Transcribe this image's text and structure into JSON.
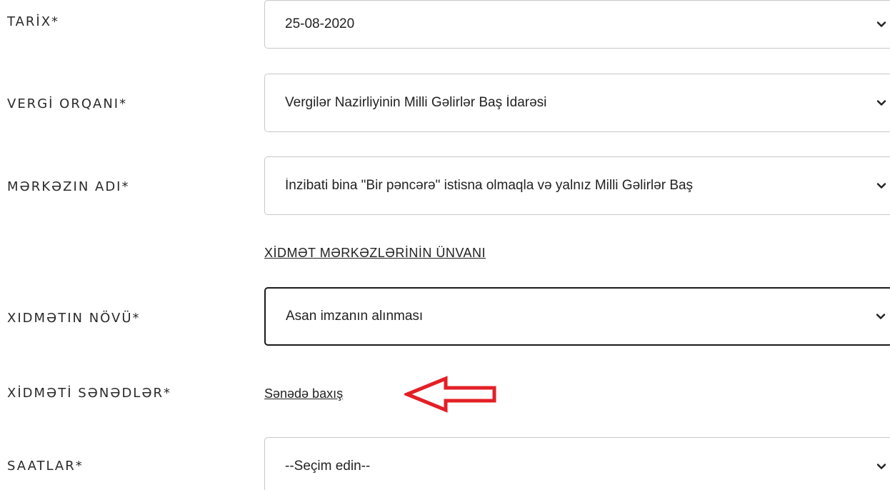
{
  "form": {
    "date_label": "TARİX*",
    "date_value": "25-08-2020",
    "tax_authority_label": "VERGİ ORQANI*",
    "tax_authority_value": "Vergilər Nazirliyinin Milli Gəlirlər Baş İdarəsi",
    "center_name_label": "MƏRKƏZIN ADI*",
    "center_name_value": "İnzibati bina \"Bir pəncərə\" istisna olmaqla və yalnız Milli Gəlirlər Baş",
    "service_centers_address_link": "XİDMƏT MƏRKƏZLƏRİNİN ÜNVANI",
    "service_type_label": "XIDMƏTIN NÖVÜ*",
    "service_type_value": "Asan imzanın alınması",
    "service_documents_label": "XİDMƏTİ SƏNƏDLƏR*",
    "document_view_link": "Sənədə baxış",
    "hours_label": "SAATLAR*",
    "hours_value": "--Seçim edin--"
  },
  "icons": {
    "dropdown": "chevron-down-icon",
    "annotation": "red-arrow-left-icon"
  },
  "colors": {
    "annotation_arrow": "#e32026",
    "select_border": "#c8c8c8",
    "focused_border": "#1b1b1b"
  }
}
